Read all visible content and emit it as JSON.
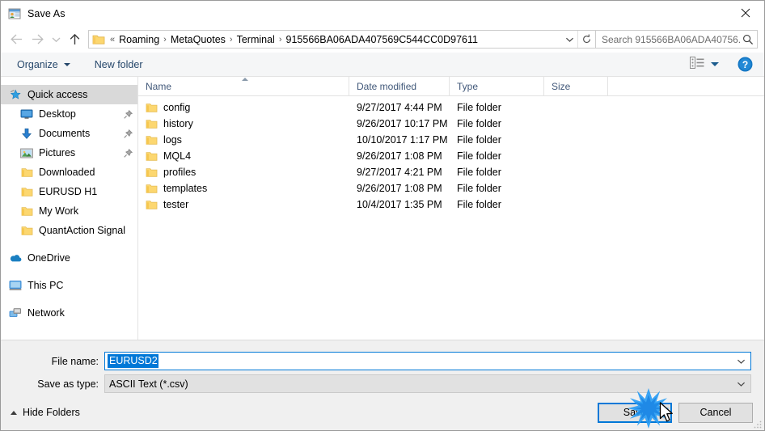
{
  "window": {
    "title": "Save As",
    "icon": "save-as-window-icon",
    "close_label": "✕"
  },
  "nav": {
    "back_icon": "back-arrow-icon",
    "forward_icon": "forward-arrow-icon",
    "recent_icon": "recent-locations-chevron-icon",
    "up_icon": "up-arrow-icon",
    "breadcrumb_prefix": "«",
    "breadcrumbs": [
      "Roaming",
      "MetaQuotes",
      "Terminal",
      "915566BA06ADA407569C544CC0D97611"
    ],
    "separator": "›",
    "dropdown_icon": "chevron-down-icon",
    "refresh_icon": "refresh-icon"
  },
  "search": {
    "placeholder": "Search 915566BA06ADA40756...",
    "value": "",
    "icon": "search-icon"
  },
  "toolbar": {
    "organize_label": "Organize",
    "new_folder_label": "New folder",
    "view_icon": "view-options-icon",
    "help_icon": "help-icon",
    "help_glyph": "?"
  },
  "sidebar": {
    "items": [
      {
        "label": "Quick access",
        "icon": "star-icon",
        "selected": true,
        "root": true,
        "pinned": false,
        "gap": false
      },
      {
        "label": "Desktop",
        "icon": "desktop-icon",
        "selected": false,
        "root": false,
        "pinned": true,
        "gap": false
      },
      {
        "label": "Documents",
        "icon": "documents-download-icon",
        "selected": false,
        "root": false,
        "pinned": true,
        "gap": false
      },
      {
        "label": "Pictures",
        "icon": "pictures-icon",
        "selected": false,
        "root": false,
        "pinned": true,
        "gap": false
      },
      {
        "label": "Downloaded",
        "icon": "folder-icon",
        "selected": false,
        "root": false,
        "pinned": false,
        "gap": false
      },
      {
        "label": "EURUSD H1",
        "icon": "folder-icon",
        "selected": false,
        "root": false,
        "pinned": false,
        "gap": false
      },
      {
        "label": "My Work",
        "icon": "folder-icon",
        "selected": false,
        "root": false,
        "pinned": false,
        "gap": false
      },
      {
        "label": "QuantAction Signal",
        "icon": "folder-icon",
        "selected": false,
        "root": false,
        "pinned": false,
        "gap": false
      },
      {
        "label": "OneDrive",
        "icon": "onedrive-cloud-icon",
        "selected": false,
        "root": true,
        "pinned": false,
        "gap": true
      },
      {
        "label": "This PC",
        "icon": "this-pc-icon",
        "selected": false,
        "root": true,
        "pinned": false,
        "gap": true
      },
      {
        "label": "Network",
        "icon": "network-icon",
        "selected": false,
        "root": true,
        "pinned": false,
        "gap": true
      }
    ]
  },
  "filelist": {
    "columns": [
      "Name",
      "Date modified",
      "Type",
      "Size"
    ],
    "sort_column": "Name",
    "sort_direction": "ascending",
    "rows": [
      {
        "name": "config",
        "date": "9/27/2017 4:44 PM",
        "type": "File folder",
        "size": ""
      },
      {
        "name": "history",
        "date": "9/26/2017 10:17 PM",
        "type": "File folder",
        "size": ""
      },
      {
        "name": "logs",
        "date": "10/10/2017 1:17 PM",
        "type": "File folder",
        "size": ""
      },
      {
        "name": "MQL4",
        "date": "9/26/2017 1:08 PM",
        "type": "File folder",
        "size": ""
      },
      {
        "name": "profiles",
        "date": "9/27/2017 4:21 PM",
        "type": "File folder",
        "size": ""
      },
      {
        "name": "templates",
        "date": "9/26/2017 1:08 PM",
        "type": "File folder",
        "size": ""
      },
      {
        "name": "tester",
        "date": "10/4/2017 1:35 PM",
        "type": "File folder",
        "size": ""
      }
    ]
  },
  "form": {
    "filename_label": "File name:",
    "filename_value": "EURUSD2",
    "filetype_label": "Save as type:",
    "filetype_value": "ASCII Text (*.csv)",
    "dropdown_icon": "chevron-down-icon"
  },
  "footer": {
    "hide_folders_label": "Hide Folders",
    "save_label": "Save",
    "cancel_label": "Cancel",
    "click_indicator": "click-burst-icon",
    "cursor": "mouse-cursor-icon"
  },
  "colors": {
    "accent": "#0078d7",
    "command_text": "#26476b",
    "header_text": "#42597a",
    "folder_yellow": "#fcd770",
    "footer_bg": "#f0f0f0"
  }
}
